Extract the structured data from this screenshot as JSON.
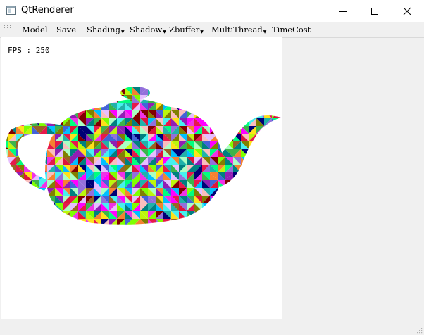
{
  "window": {
    "title": "QtRenderer"
  },
  "toolbar": {
    "items": [
      {
        "label": "Model",
        "has_menu": false
      },
      {
        "label": "Save",
        "has_menu": false
      },
      {
        "label": "Shading",
        "has_menu": true
      },
      {
        "label": "Shadow",
        "has_menu": true
      },
      {
        "label": "Zbuffer",
        "has_menu": true
      },
      {
        "label": "MultiThread",
        "has_menu": true
      },
      {
        "label": "TimeCost",
        "has_menu": false
      }
    ]
  },
  "viewport": {
    "fps_text": "FPS : 250",
    "rendered_object": "teapot",
    "render_style": "random-color-per-triangle"
  },
  "colors": {
    "canvas_background": "#ffffff",
    "window_background": "#f0f0f0",
    "triangle_palette": [
      "#e6194b",
      "#3cb44b",
      "#ffe119",
      "#4363d8",
      "#f58231",
      "#911eb4",
      "#46f0f0",
      "#f032e6",
      "#bcf60c",
      "#fabebe",
      "#008080",
      "#e6beff",
      "#9a6324",
      "#800000",
      "#aaffc3",
      "#808000",
      "#000075",
      "#00ff7f",
      "#ff00ff",
      "#00bfff",
      "#7fff00",
      "#dc143c",
      "#20b2aa",
      "#9370db"
    ]
  }
}
